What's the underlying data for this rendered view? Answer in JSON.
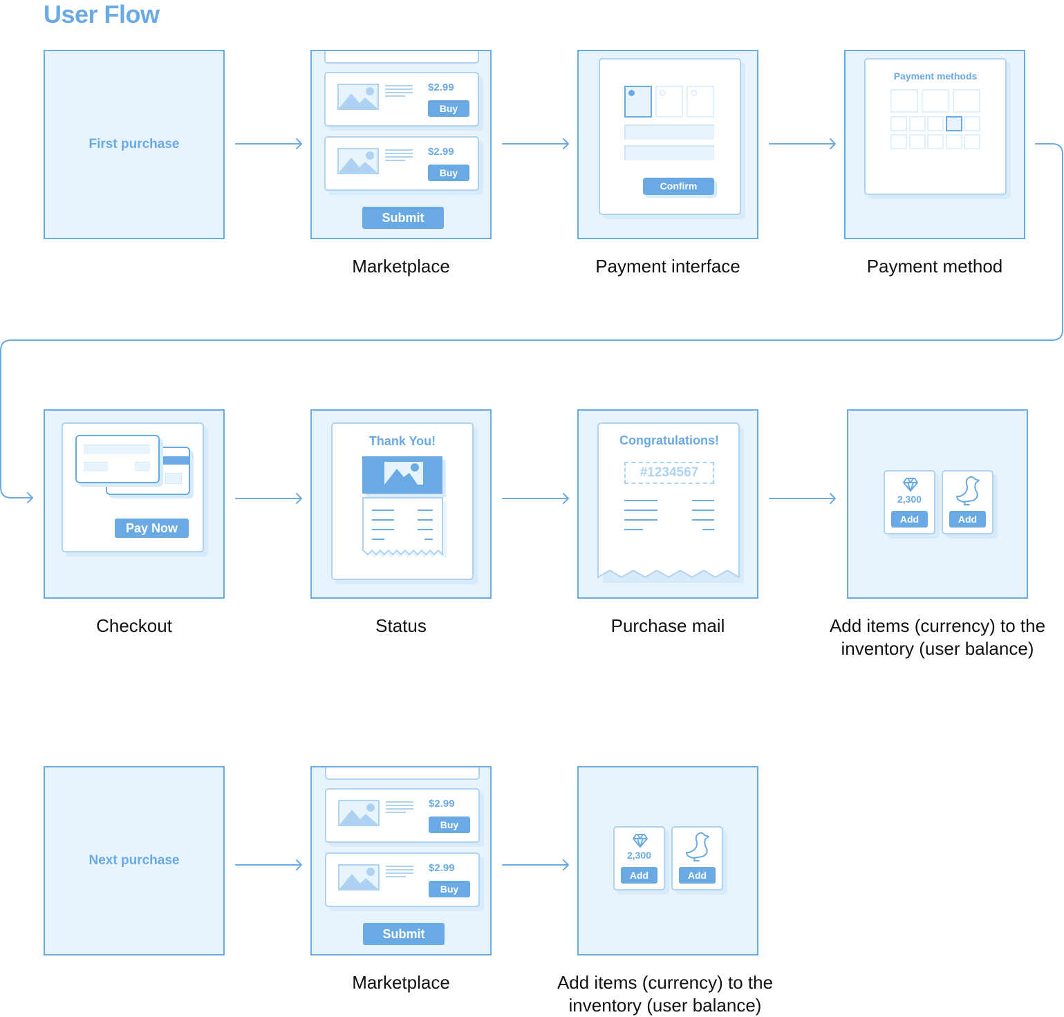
{
  "page": {
    "title": "User Flow"
  },
  "colors": {
    "accent": "#6aaae4",
    "frame_bg": "#e8f4fd",
    "light": "#aed2f1"
  },
  "row1": {
    "start": {
      "label": "First purchase"
    },
    "marketplace": {
      "caption": "Marketplace",
      "items": [
        {
          "price": "$2.99",
          "button": "Buy"
        },
        {
          "price": "$2.99",
          "button": "Buy"
        }
      ],
      "submit": "Submit"
    },
    "payment_interface": {
      "caption": "Payment interface",
      "confirm": "Confirm"
    },
    "payment_method": {
      "caption": "Payment method",
      "heading": "Payment methods"
    }
  },
  "row2": {
    "checkout": {
      "caption": "Checkout",
      "button": "Pay Now"
    },
    "status": {
      "caption": "Status",
      "heading": "Thank You!"
    },
    "purchase_mail": {
      "caption": "Purchase mail",
      "heading": "Congratulations!",
      "order_number": "#1234567"
    },
    "add_items": {
      "caption_line1": "Add items (currency) to the",
      "caption_line2": "inventory (user balance)",
      "gem_amount": "2,300",
      "add_label": "Add",
      "add_label_2": "Add"
    }
  },
  "row3": {
    "start": {
      "label": "Next purchase"
    },
    "marketplace": {
      "caption": "Marketplace",
      "items": [
        {
          "price": "$2.99",
          "button": "Buy"
        },
        {
          "price": "$2.99",
          "button": "Buy"
        }
      ],
      "submit": "Submit"
    },
    "add_items": {
      "caption_line1": "Add items (currency) to the",
      "caption_line2": "inventory (user balance)",
      "gem_amount": "2,300",
      "add_label": "Add",
      "add_label_2": "Add"
    }
  }
}
